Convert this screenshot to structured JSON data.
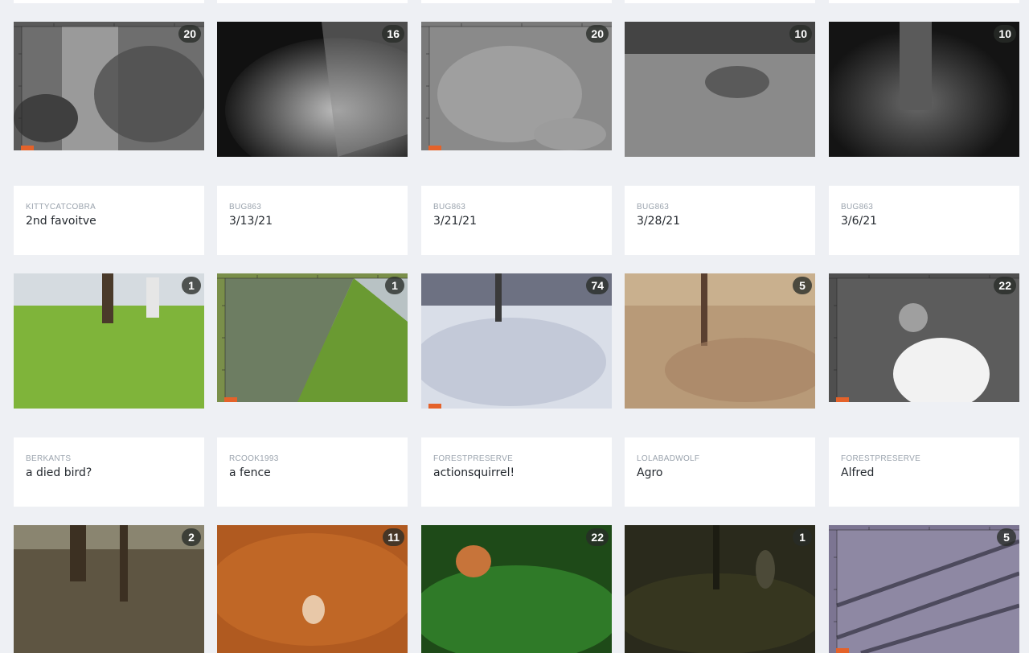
{
  "gallery": {
    "rows": [
      {
        "cards": [
          {
            "owner": "KITTYCATCOBRA",
            "title": "2nd favoitve",
            "count": "20",
            "scene": "night-tree-grid"
          },
          {
            "owner": "BUG863",
            "title": "3/13/21",
            "count": "16",
            "scene": "night-fence"
          },
          {
            "owner": "BUG863",
            "title": "3/21/21",
            "count": "20",
            "scene": "night-grass-grid"
          },
          {
            "owner": "BUG863",
            "title": "3/28/21",
            "count": "10",
            "scene": "day-leaves-gray"
          },
          {
            "owner": "BUG863",
            "title": "3/6/21",
            "count": "10",
            "scene": "night-dark-tree"
          }
        ]
      },
      {
        "cards": [
          {
            "owner": "BERKANTS",
            "title": "a died bird?",
            "count": "1",
            "scene": "cemetery-grass"
          },
          {
            "owner": "RCOOK1993",
            "title": "a fence",
            "count": "1",
            "scene": "fence-grass-grid"
          },
          {
            "owner": "FORESTPRESERVE",
            "title": "actionsquirrel!",
            "count": "74",
            "scene": "snow-forest"
          },
          {
            "owner": "LOLABADWOLF",
            "title": "Agro",
            "count": "5",
            "scene": "autumn-leaves"
          },
          {
            "owner": "FORESTPRESERVE",
            "title": "Alfred",
            "count": "22",
            "scene": "night-white-blob"
          }
        ]
      },
      {
        "cards": [
          {
            "owner": "",
            "title": "",
            "count": "2",
            "scene": "brown-woods"
          },
          {
            "owner": "",
            "title": "",
            "count": "11",
            "scene": "orange-leaves-dog"
          },
          {
            "owner": "",
            "title": "",
            "count": "22",
            "scene": "green-fox"
          },
          {
            "owner": "",
            "title": "",
            "count": "1",
            "scene": "dark-forest-deer"
          },
          {
            "owner": "",
            "title": "",
            "count": "5",
            "scene": "branches-blue"
          }
        ]
      }
    ]
  },
  "colors": {
    "background": "#eef0f4",
    "card": "#ffffff",
    "owner_text": "#9aa3ad",
    "title_text": "#24292f",
    "badge_bg": "#2e322e",
    "tag": "#e4622a"
  }
}
